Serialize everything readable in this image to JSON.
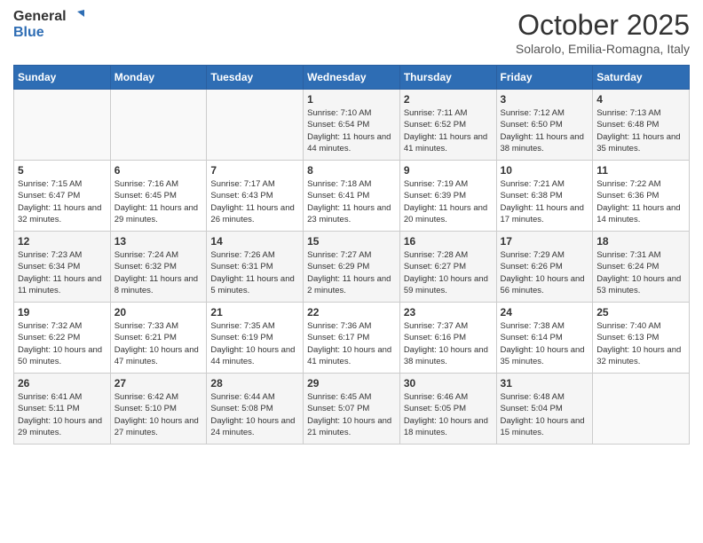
{
  "header": {
    "logo_line1": "General",
    "logo_line2": "Blue",
    "month_title": "October 2025",
    "subtitle": "Solarolo, Emilia-Romagna, Italy"
  },
  "days_of_week": [
    "Sunday",
    "Monday",
    "Tuesday",
    "Wednesday",
    "Thursday",
    "Friday",
    "Saturday"
  ],
  "weeks": [
    [
      {
        "day": "",
        "info": ""
      },
      {
        "day": "",
        "info": ""
      },
      {
        "day": "",
        "info": ""
      },
      {
        "day": "1",
        "info": "Sunrise: 7:10 AM\nSunset: 6:54 PM\nDaylight: 11 hours and 44 minutes."
      },
      {
        "day": "2",
        "info": "Sunrise: 7:11 AM\nSunset: 6:52 PM\nDaylight: 11 hours and 41 minutes."
      },
      {
        "day": "3",
        "info": "Sunrise: 7:12 AM\nSunset: 6:50 PM\nDaylight: 11 hours and 38 minutes."
      },
      {
        "day": "4",
        "info": "Sunrise: 7:13 AM\nSunset: 6:48 PM\nDaylight: 11 hours and 35 minutes."
      }
    ],
    [
      {
        "day": "5",
        "info": "Sunrise: 7:15 AM\nSunset: 6:47 PM\nDaylight: 11 hours and 32 minutes."
      },
      {
        "day": "6",
        "info": "Sunrise: 7:16 AM\nSunset: 6:45 PM\nDaylight: 11 hours and 29 minutes."
      },
      {
        "day": "7",
        "info": "Sunrise: 7:17 AM\nSunset: 6:43 PM\nDaylight: 11 hours and 26 minutes."
      },
      {
        "day": "8",
        "info": "Sunrise: 7:18 AM\nSunset: 6:41 PM\nDaylight: 11 hours and 23 minutes."
      },
      {
        "day": "9",
        "info": "Sunrise: 7:19 AM\nSunset: 6:39 PM\nDaylight: 11 hours and 20 minutes."
      },
      {
        "day": "10",
        "info": "Sunrise: 7:21 AM\nSunset: 6:38 PM\nDaylight: 11 hours and 17 minutes."
      },
      {
        "day": "11",
        "info": "Sunrise: 7:22 AM\nSunset: 6:36 PM\nDaylight: 11 hours and 14 minutes."
      }
    ],
    [
      {
        "day": "12",
        "info": "Sunrise: 7:23 AM\nSunset: 6:34 PM\nDaylight: 11 hours and 11 minutes."
      },
      {
        "day": "13",
        "info": "Sunrise: 7:24 AM\nSunset: 6:32 PM\nDaylight: 11 hours and 8 minutes."
      },
      {
        "day": "14",
        "info": "Sunrise: 7:26 AM\nSunset: 6:31 PM\nDaylight: 11 hours and 5 minutes."
      },
      {
        "day": "15",
        "info": "Sunrise: 7:27 AM\nSunset: 6:29 PM\nDaylight: 11 hours and 2 minutes."
      },
      {
        "day": "16",
        "info": "Sunrise: 7:28 AM\nSunset: 6:27 PM\nDaylight: 10 hours and 59 minutes."
      },
      {
        "day": "17",
        "info": "Sunrise: 7:29 AM\nSunset: 6:26 PM\nDaylight: 10 hours and 56 minutes."
      },
      {
        "day": "18",
        "info": "Sunrise: 7:31 AM\nSunset: 6:24 PM\nDaylight: 10 hours and 53 minutes."
      }
    ],
    [
      {
        "day": "19",
        "info": "Sunrise: 7:32 AM\nSunset: 6:22 PM\nDaylight: 10 hours and 50 minutes."
      },
      {
        "day": "20",
        "info": "Sunrise: 7:33 AM\nSunset: 6:21 PM\nDaylight: 10 hours and 47 minutes."
      },
      {
        "day": "21",
        "info": "Sunrise: 7:35 AM\nSunset: 6:19 PM\nDaylight: 10 hours and 44 minutes."
      },
      {
        "day": "22",
        "info": "Sunrise: 7:36 AM\nSunset: 6:17 PM\nDaylight: 10 hours and 41 minutes."
      },
      {
        "day": "23",
        "info": "Sunrise: 7:37 AM\nSunset: 6:16 PM\nDaylight: 10 hours and 38 minutes."
      },
      {
        "day": "24",
        "info": "Sunrise: 7:38 AM\nSunset: 6:14 PM\nDaylight: 10 hours and 35 minutes."
      },
      {
        "day": "25",
        "info": "Sunrise: 7:40 AM\nSunset: 6:13 PM\nDaylight: 10 hours and 32 minutes."
      }
    ],
    [
      {
        "day": "26",
        "info": "Sunrise: 6:41 AM\nSunset: 5:11 PM\nDaylight: 10 hours and 29 minutes."
      },
      {
        "day": "27",
        "info": "Sunrise: 6:42 AM\nSunset: 5:10 PM\nDaylight: 10 hours and 27 minutes."
      },
      {
        "day": "28",
        "info": "Sunrise: 6:44 AM\nSunset: 5:08 PM\nDaylight: 10 hours and 24 minutes."
      },
      {
        "day": "29",
        "info": "Sunrise: 6:45 AM\nSunset: 5:07 PM\nDaylight: 10 hours and 21 minutes."
      },
      {
        "day": "30",
        "info": "Sunrise: 6:46 AM\nSunset: 5:05 PM\nDaylight: 10 hours and 18 minutes."
      },
      {
        "day": "31",
        "info": "Sunrise: 6:48 AM\nSunset: 5:04 PM\nDaylight: 10 hours and 15 minutes."
      },
      {
        "day": "",
        "info": ""
      }
    ]
  ]
}
